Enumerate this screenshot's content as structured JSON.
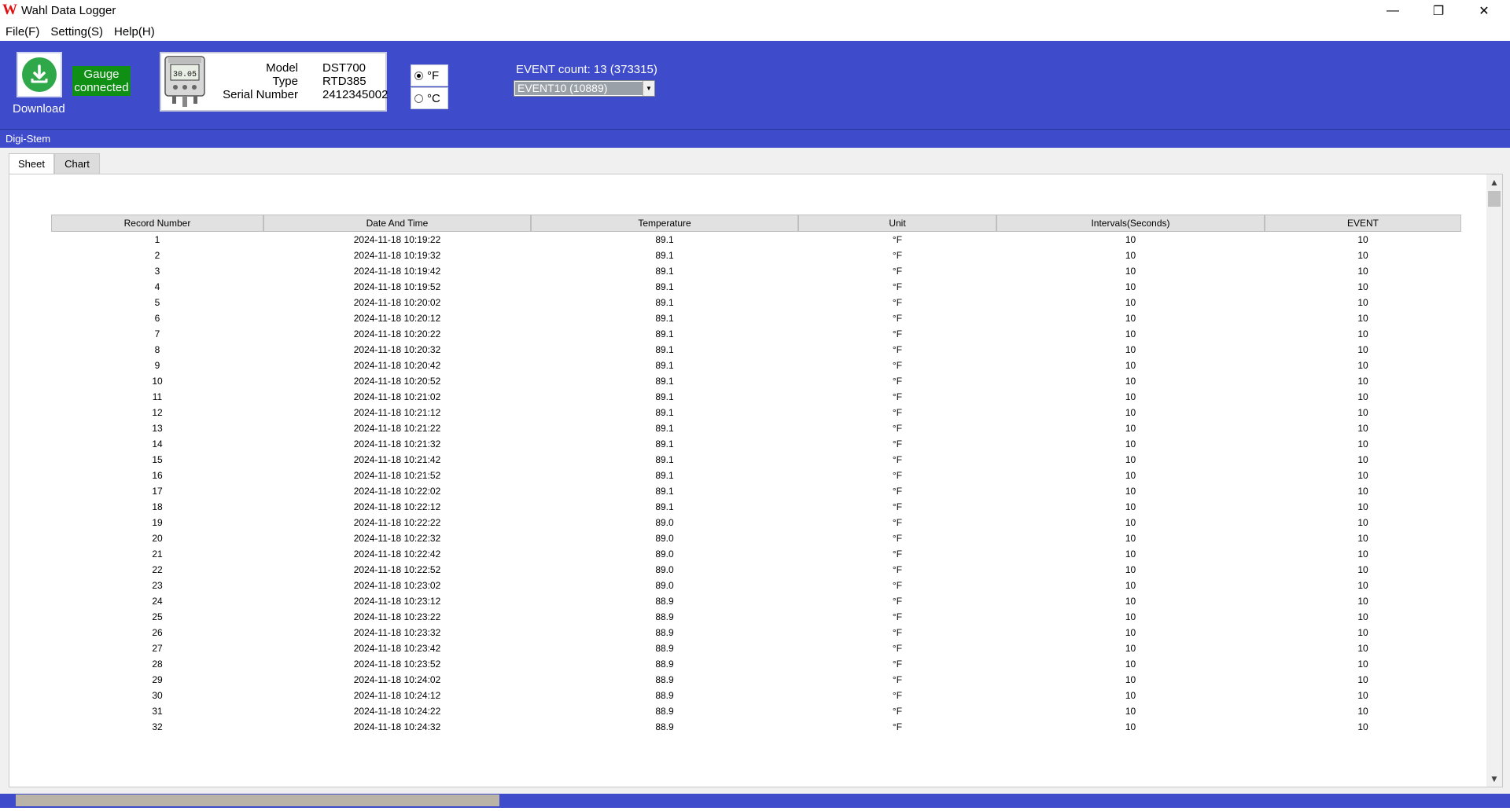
{
  "window": {
    "title": "Wahl Data Logger",
    "logo_letter": "W",
    "minimize_glyph": "—",
    "maximize_glyph": "❐",
    "close_glyph": "✕"
  },
  "menu": [
    "File(F)",
    "Setting(S)",
    "Help(H)"
  ],
  "toolbar": {
    "download_label": "Download",
    "gauge_status_line1": "Gauge",
    "gauge_status_line2": "connected",
    "device": {
      "display_reading": "30.05",
      "model_label": "Model",
      "model_value": "DST700",
      "type_label": "Type",
      "type_value": "RTD385",
      "serial_label": "Serial Number",
      "serial_value": "2412345002"
    },
    "unit_f": "°F",
    "unit_c": "°C",
    "unit_selected": "F",
    "event_count_text": "EVENT count: 13   (373315)",
    "event_select_value": "EVENT10    (10889)"
  },
  "section_title": "Digi-Stem",
  "tabs": [
    "Sheet",
    "Chart"
  ],
  "table": {
    "headers": [
      "Record Number",
      "Date And Time",
      "Temperature",
      "Unit",
      "Intervals(Seconds)",
      "EVENT"
    ],
    "rows": [
      [
        "1",
        "2024-11-18 10:19:22",
        "89.1",
        "°F",
        "10",
        "10"
      ],
      [
        "2",
        "2024-11-18 10:19:32",
        "89.1",
        "°F",
        "10",
        "10"
      ],
      [
        "3",
        "2024-11-18 10:19:42",
        "89.1",
        "°F",
        "10",
        "10"
      ],
      [
        "4",
        "2024-11-18 10:19:52",
        "89.1",
        "°F",
        "10",
        "10"
      ],
      [
        "5",
        "2024-11-18 10:20:02",
        "89.1",
        "°F",
        "10",
        "10"
      ],
      [
        "6",
        "2024-11-18 10:20:12",
        "89.1",
        "°F",
        "10",
        "10"
      ],
      [
        "7",
        "2024-11-18 10:20:22",
        "89.1",
        "°F",
        "10",
        "10"
      ],
      [
        "8",
        "2024-11-18 10:20:32",
        "89.1",
        "°F",
        "10",
        "10"
      ],
      [
        "9",
        "2024-11-18 10:20:42",
        "89.1",
        "°F",
        "10",
        "10"
      ],
      [
        "10",
        "2024-11-18 10:20:52",
        "89.1",
        "°F",
        "10",
        "10"
      ],
      [
        "11",
        "2024-11-18 10:21:02",
        "89.1",
        "°F",
        "10",
        "10"
      ],
      [
        "12",
        "2024-11-18 10:21:12",
        "89.1",
        "°F",
        "10",
        "10"
      ],
      [
        "13",
        "2024-11-18 10:21:22",
        "89.1",
        "°F",
        "10",
        "10"
      ],
      [
        "14",
        "2024-11-18 10:21:32",
        "89.1",
        "°F",
        "10",
        "10"
      ],
      [
        "15",
        "2024-11-18 10:21:42",
        "89.1",
        "°F",
        "10",
        "10"
      ],
      [
        "16",
        "2024-11-18 10:21:52",
        "89.1",
        "°F",
        "10",
        "10"
      ],
      [
        "17",
        "2024-11-18 10:22:02",
        "89.1",
        "°F",
        "10",
        "10"
      ],
      [
        "18",
        "2024-11-18 10:22:12",
        "89.1",
        "°F",
        "10",
        "10"
      ],
      [
        "19",
        "2024-11-18 10:22:22",
        "89.0",
        "°F",
        "10",
        "10"
      ],
      [
        "20",
        "2024-11-18 10:22:32",
        "89.0",
        "°F",
        "10",
        "10"
      ],
      [
        "21",
        "2024-11-18 10:22:42",
        "89.0",
        "°F",
        "10",
        "10"
      ],
      [
        "22",
        "2024-11-18 10:22:52",
        "89.0",
        "°F",
        "10",
        "10"
      ],
      [
        "23",
        "2024-11-18 10:23:02",
        "89.0",
        "°F",
        "10",
        "10"
      ],
      [
        "24",
        "2024-11-18 10:23:12",
        "88.9",
        "°F",
        "10",
        "10"
      ],
      [
        "25",
        "2024-11-18 10:23:22",
        "88.9",
        "°F",
        "10",
        "10"
      ],
      [
        "26",
        "2024-11-18 10:23:32",
        "88.9",
        "°F",
        "10",
        "10"
      ],
      [
        "27",
        "2024-11-18 10:23:42",
        "88.9",
        "°F",
        "10",
        "10"
      ],
      [
        "28",
        "2024-11-18 10:23:52",
        "88.9",
        "°F",
        "10",
        "10"
      ],
      [
        "29",
        "2024-11-18 10:24:02",
        "88.9",
        "°F",
        "10",
        "10"
      ],
      [
        "30",
        "2024-11-18 10:24:12",
        "88.9",
        "°F",
        "10",
        "10"
      ],
      [
        "31",
        "2024-11-18 10:24:22",
        "88.9",
        "°F",
        "10",
        "10"
      ],
      [
        "32",
        "2024-11-18 10:24:32",
        "88.9",
        "°F",
        "10",
        "10"
      ]
    ]
  },
  "colors": {
    "toolbar_blue": "#3e4bcb",
    "gauge_green": "#0f8f14",
    "download_green": "#2fa84a",
    "logo_red": "#e01010"
  }
}
